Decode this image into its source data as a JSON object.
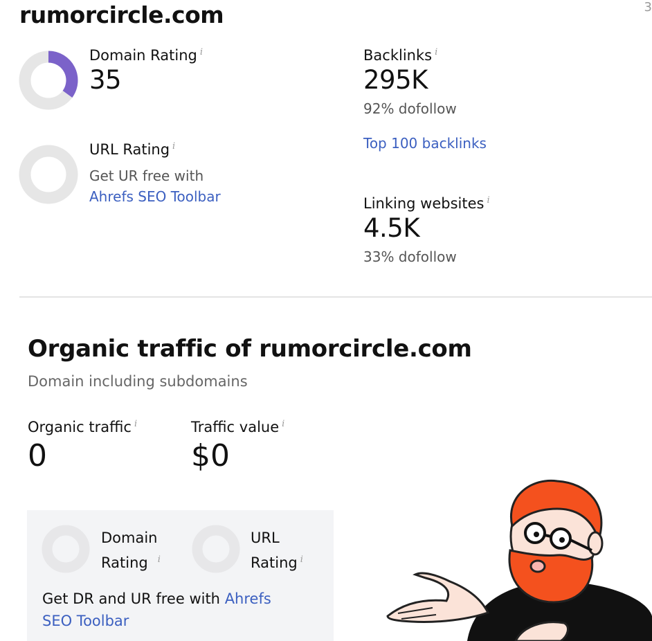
{
  "domain": "rumorcircle.com",
  "edge_mark": "3",
  "overview": {
    "domain_rating": {
      "label": "Domain Rating",
      "info": "i",
      "value": "35",
      "gauge_fraction": 0.35
    },
    "url_rating": {
      "label": "URL Rating",
      "info": "i",
      "note": "Get UR free with",
      "link": "Ahrefs SEO Toolbar"
    },
    "backlinks": {
      "label": "Backlinks",
      "info": "i",
      "value": "295K",
      "dofollow": "92% dofollow",
      "link": "Top 100 backlinks"
    },
    "linking_websites": {
      "label": "Linking websites",
      "info": "i",
      "value": "4.5K",
      "dofollow": "33% dofollow"
    }
  },
  "organic": {
    "title": "Organic traffic of rumorcircle.com",
    "subtitle": "Domain including subdomains",
    "traffic": {
      "label": "Organic traffic",
      "info": "i",
      "value": "0"
    },
    "value": {
      "label": "Traffic value",
      "info": "i",
      "value": "$0"
    }
  },
  "promo": {
    "dr_label_1": "Domain",
    "dr_label_2": "Rating",
    "ur_label_1": "URL",
    "ur_label_2": "Rating",
    "info": "i",
    "text": "Get DR and UR free with",
    "link_1": "Ahrefs",
    "link_2": "SEO Toolbar"
  },
  "colors": {
    "accent": "#7b62c9",
    "gauge_track": "#e6e6e6",
    "link": "#3b5fc0",
    "mascot_hair": "#f4511e"
  }
}
